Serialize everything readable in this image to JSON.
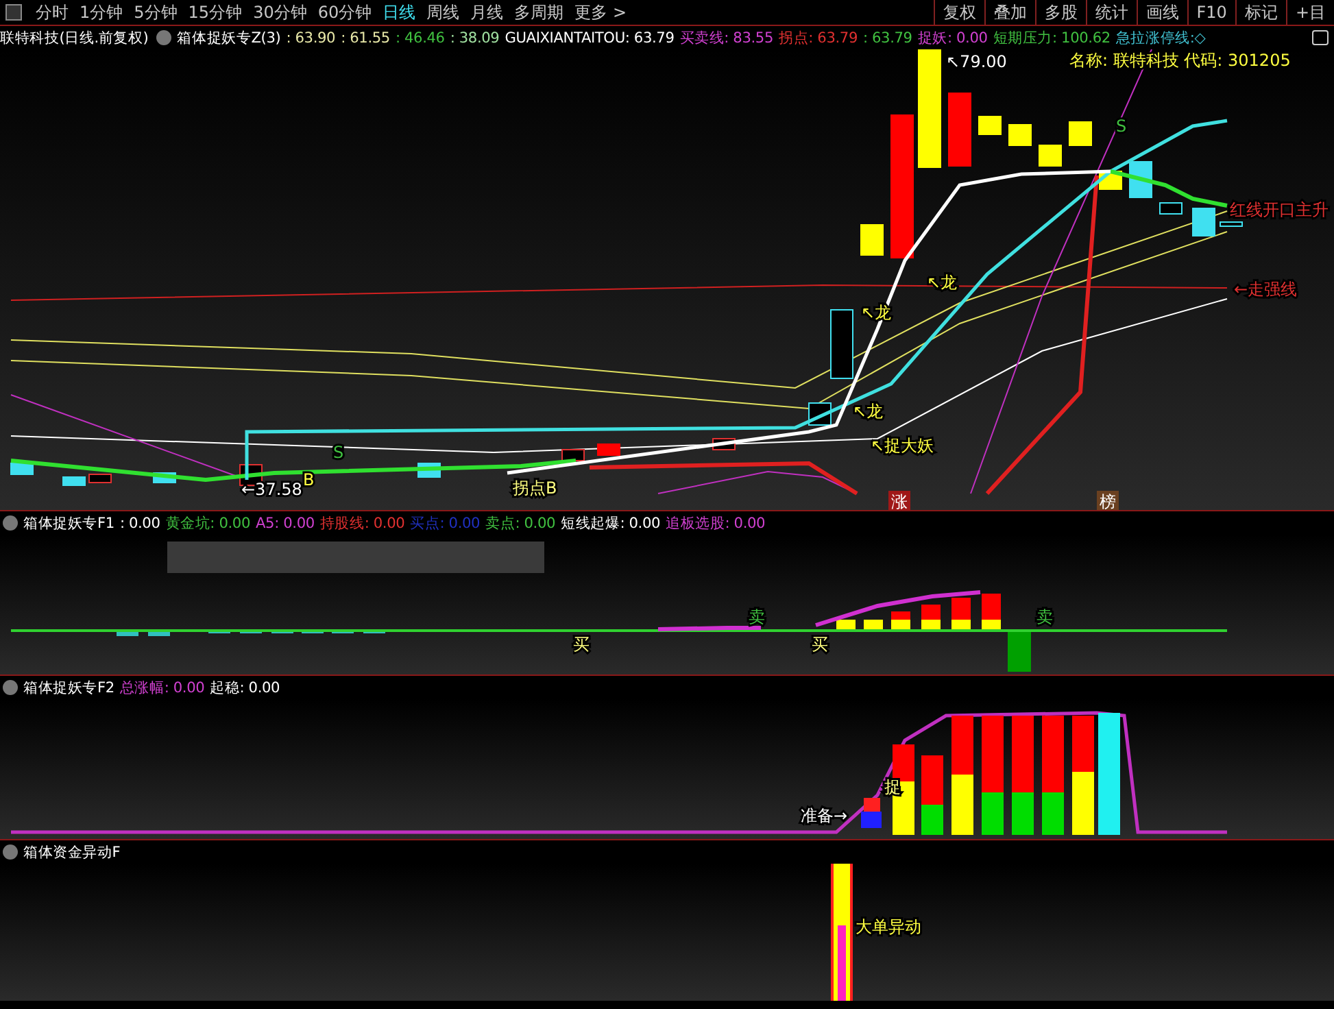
{
  "menu_bar": {
    "period_tabs": [
      {
        "label": "分时",
        "selected": false
      },
      {
        "label": "1分钟",
        "selected": false
      },
      {
        "label": "5分钟",
        "selected": false
      },
      {
        "label": "15分钟",
        "selected": false
      },
      {
        "label": "30分钟",
        "selected": false
      },
      {
        "label": "60分钟",
        "selected": false
      },
      {
        "label": "日线",
        "selected": true
      },
      {
        "label": "周线",
        "selected": false
      },
      {
        "label": "月线",
        "selected": false
      },
      {
        "label": "多周期",
        "selected": false
      },
      {
        "label": "更多 >",
        "selected": false
      }
    ],
    "buttons": [
      "复权",
      "叠加",
      "多股",
      "统计",
      "画线",
      "F10",
      "标记",
      "+目"
    ]
  },
  "main_panel": {
    "stock": "联特科技(日线.前复权)",
    "indicator": "箱体捉妖专Z(3)",
    "values": [
      {
        "text": ": 63.90",
        "color": "#e8e8a8"
      },
      {
        "text": ": 61.55",
        "color": "#e8e8a8"
      },
      {
        "text": ": 46.46",
        "color": "#40c040"
      },
      {
        "text": ": 38.09",
        "color": "#a0e0a0"
      },
      {
        "text": "GUAIXIANTAITOU: 63.79",
        "color": "#ffffff"
      },
      {
        "text": "买卖线: 83.55",
        "color": "#d040d0"
      },
      {
        "text": "拐点: 63.79",
        "color": "#e03030"
      },
      {
        "text": ": 63.79",
        "color": "#40c040"
      },
      {
        "text": "捉妖: 0.00",
        "color": "#d040d0"
      },
      {
        "text": "短期压力: 100.62",
        "color": "#40c040"
      },
      {
        "text": "急拉涨停线:◇",
        "color": "#40c0d0"
      }
    ],
    "labels": [
      {
        "text": "↖79.00",
        "color": "#ffffff"
      },
      {
        "text": "名称: 联特科技 代码: 301205",
        "color": "#ffff40"
      },
      {
        "text": "S",
        "color": "#40c040"
      },
      {
        "text": "红线开口主升",
        "color": "#e03030"
      },
      {
        "text": "←走强线",
        "color": "#e03030"
      },
      {
        "text": "↖龙",
        "color": "#ffff40"
      },
      {
        "text": "↖龙",
        "color": "#ffff40"
      },
      {
        "text": "↖龙",
        "color": "#ffff40"
      },
      {
        "text": "↖捉大妖",
        "color": "#ffff40"
      },
      {
        "text": "←37.58",
        "color": "#ffffff"
      },
      {
        "text": "B",
        "color": "#ffff40"
      },
      {
        "text": "S",
        "color": "#40c040"
      },
      {
        "text": "拐点B",
        "color": "#ffff80"
      }
    ],
    "badges": [
      {
        "text": "涨",
        "color": "#a01818"
      },
      {
        "text": "榜",
        "color": "#6a4020"
      }
    ]
  },
  "f1_panel": {
    "indicator": "箱体捉妖专F1",
    "values": [
      {
        "text": ": 0.00",
        "color": "#ffffff"
      },
      {
        "text": "黄金坑: 0.00",
        "color": "#40c040"
      },
      {
        "text": "A5: 0.00",
        "color": "#d040d0"
      },
      {
        "text": "持股线: 0.00",
        "color": "#e03030"
      },
      {
        "text": "买点: 0.00",
        "color": "#2030c0"
      },
      {
        "text": "卖点: 0.00",
        "color": "#40c040"
      },
      {
        "text": "短线起爆: 0.00",
        "color": "#ffffff"
      },
      {
        "text": "追板选股: 0.00",
        "color": "#d040d0"
      }
    ],
    "labels": [
      {
        "text": "买",
        "color": "#ffff80"
      },
      {
        "text": "卖",
        "color": "#40c040"
      },
      {
        "text": "买",
        "color": "#ffff80"
      },
      {
        "text": "卖",
        "color": "#40c040"
      }
    ]
  },
  "f2_panel": {
    "indicator": "箱体捉妖专F2",
    "values": [
      {
        "text": "总涨幅: 0.00",
        "color": "#d040d0"
      },
      {
        "text": "起稳: 0.00",
        "color": "#ffffff"
      }
    ],
    "labels": [
      {
        "text": "捉",
        "color": "#ffff80"
      },
      {
        "text": "准备→",
        "color": "#ffffff"
      }
    ]
  },
  "fund_panel": {
    "indicator": "箱体资金异动F",
    "labels": [
      {
        "text": "大单异动",
        "color": "#ffff40"
      }
    ]
  }
}
